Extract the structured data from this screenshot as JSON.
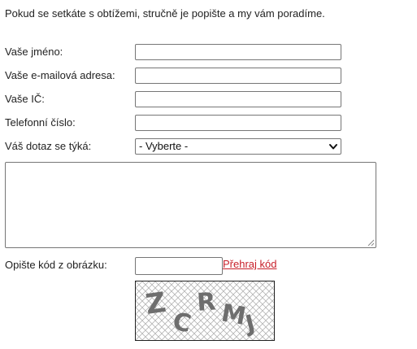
{
  "intro_text": "Pokud se setkáte s obtížemi, stručně je popište a my vám poradíme.",
  "form": {
    "name_label": "Vaše jméno:",
    "name_value": "",
    "email_label": "Vaše e-mailová adresa:",
    "email_value": "",
    "ic_label": "Vaše IČ:",
    "ic_value": "",
    "phone_label": "Telefonní číslo:",
    "phone_value": "",
    "topic_label": "Váš dotaz se týká:",
    "topic_selected": "- Vyberte -",
    "message_value": "",
    "captcha_label": "Opište kód z obrázku:",
    "captcha_value": "",
    "replay_link": "Přehraj kód",
    "captcha_text": "ZCRMJ"
  },
  "colors": {
    "link": "#c8202a",
    "captcha_letters": "#6e6e6e",
    "captcha_grid": "#b4b4b4"
  },
  "icons": {
    "select_arrow": "chevron-down-icon",
    "textarea_grip": "resize-grip-icon"
  }
}
